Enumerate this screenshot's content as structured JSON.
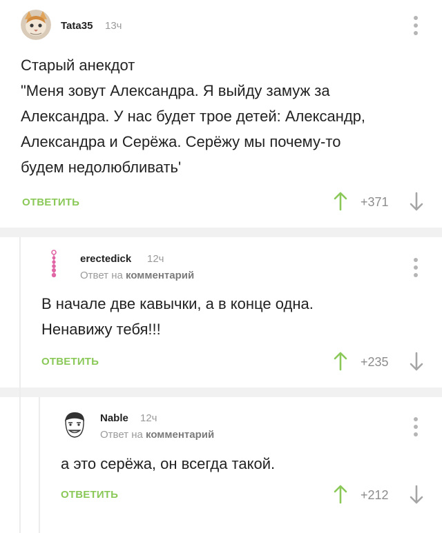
{
  "comments": [
    {
      "username": "Tata35",
      "time": "13ч",
      "text_lines": [
        "Старый анекдот",
        "\"Меня зовут Александра. Я выйду замуж за",
        "Александра. У нас будет трое детей: Александр,",
        "Александра и Серёжа. Серёжу мы почему-то",
        "будем недолюбливать'"
      ],
      "reply_label": "ОТВЕТИТЬ",
      "rating": "+371",
      "avatar_icon": "cat-avatar-icon"
    },
    {
      "username": "erectedick",
      "time": "12ч",
      "reply_prefix": "Ответ на",
      "reply_target": "комментарий",
      "text_lines": [
        "В начале две кавычки, а в конце одна.",
        "Ненавижу тебя!!!"
      ],
      "reply_label": "ОТВЕТИТЬ",
      "rating": "+235",
      "avatar_icon": "bead-string-avatar-icon"
    },
    {
      "username": "Nable",
      "time": "12ч",
      "reply_prefix": "Ответ на",
      "reply_target": "комментарий",
      "text_lines": [
        "а это серёжа, он всегда такой."
      ],
      "reply_label": "ОТВЕТИТЬ",
      "rating": "+212",
      "avatar_icon": "meme-face-avatar-icon"
    }
  ],
  "colors": {
    "accent_green": "#8ac858",
    "muted_gray": "#9a9a9a"
  }
}
